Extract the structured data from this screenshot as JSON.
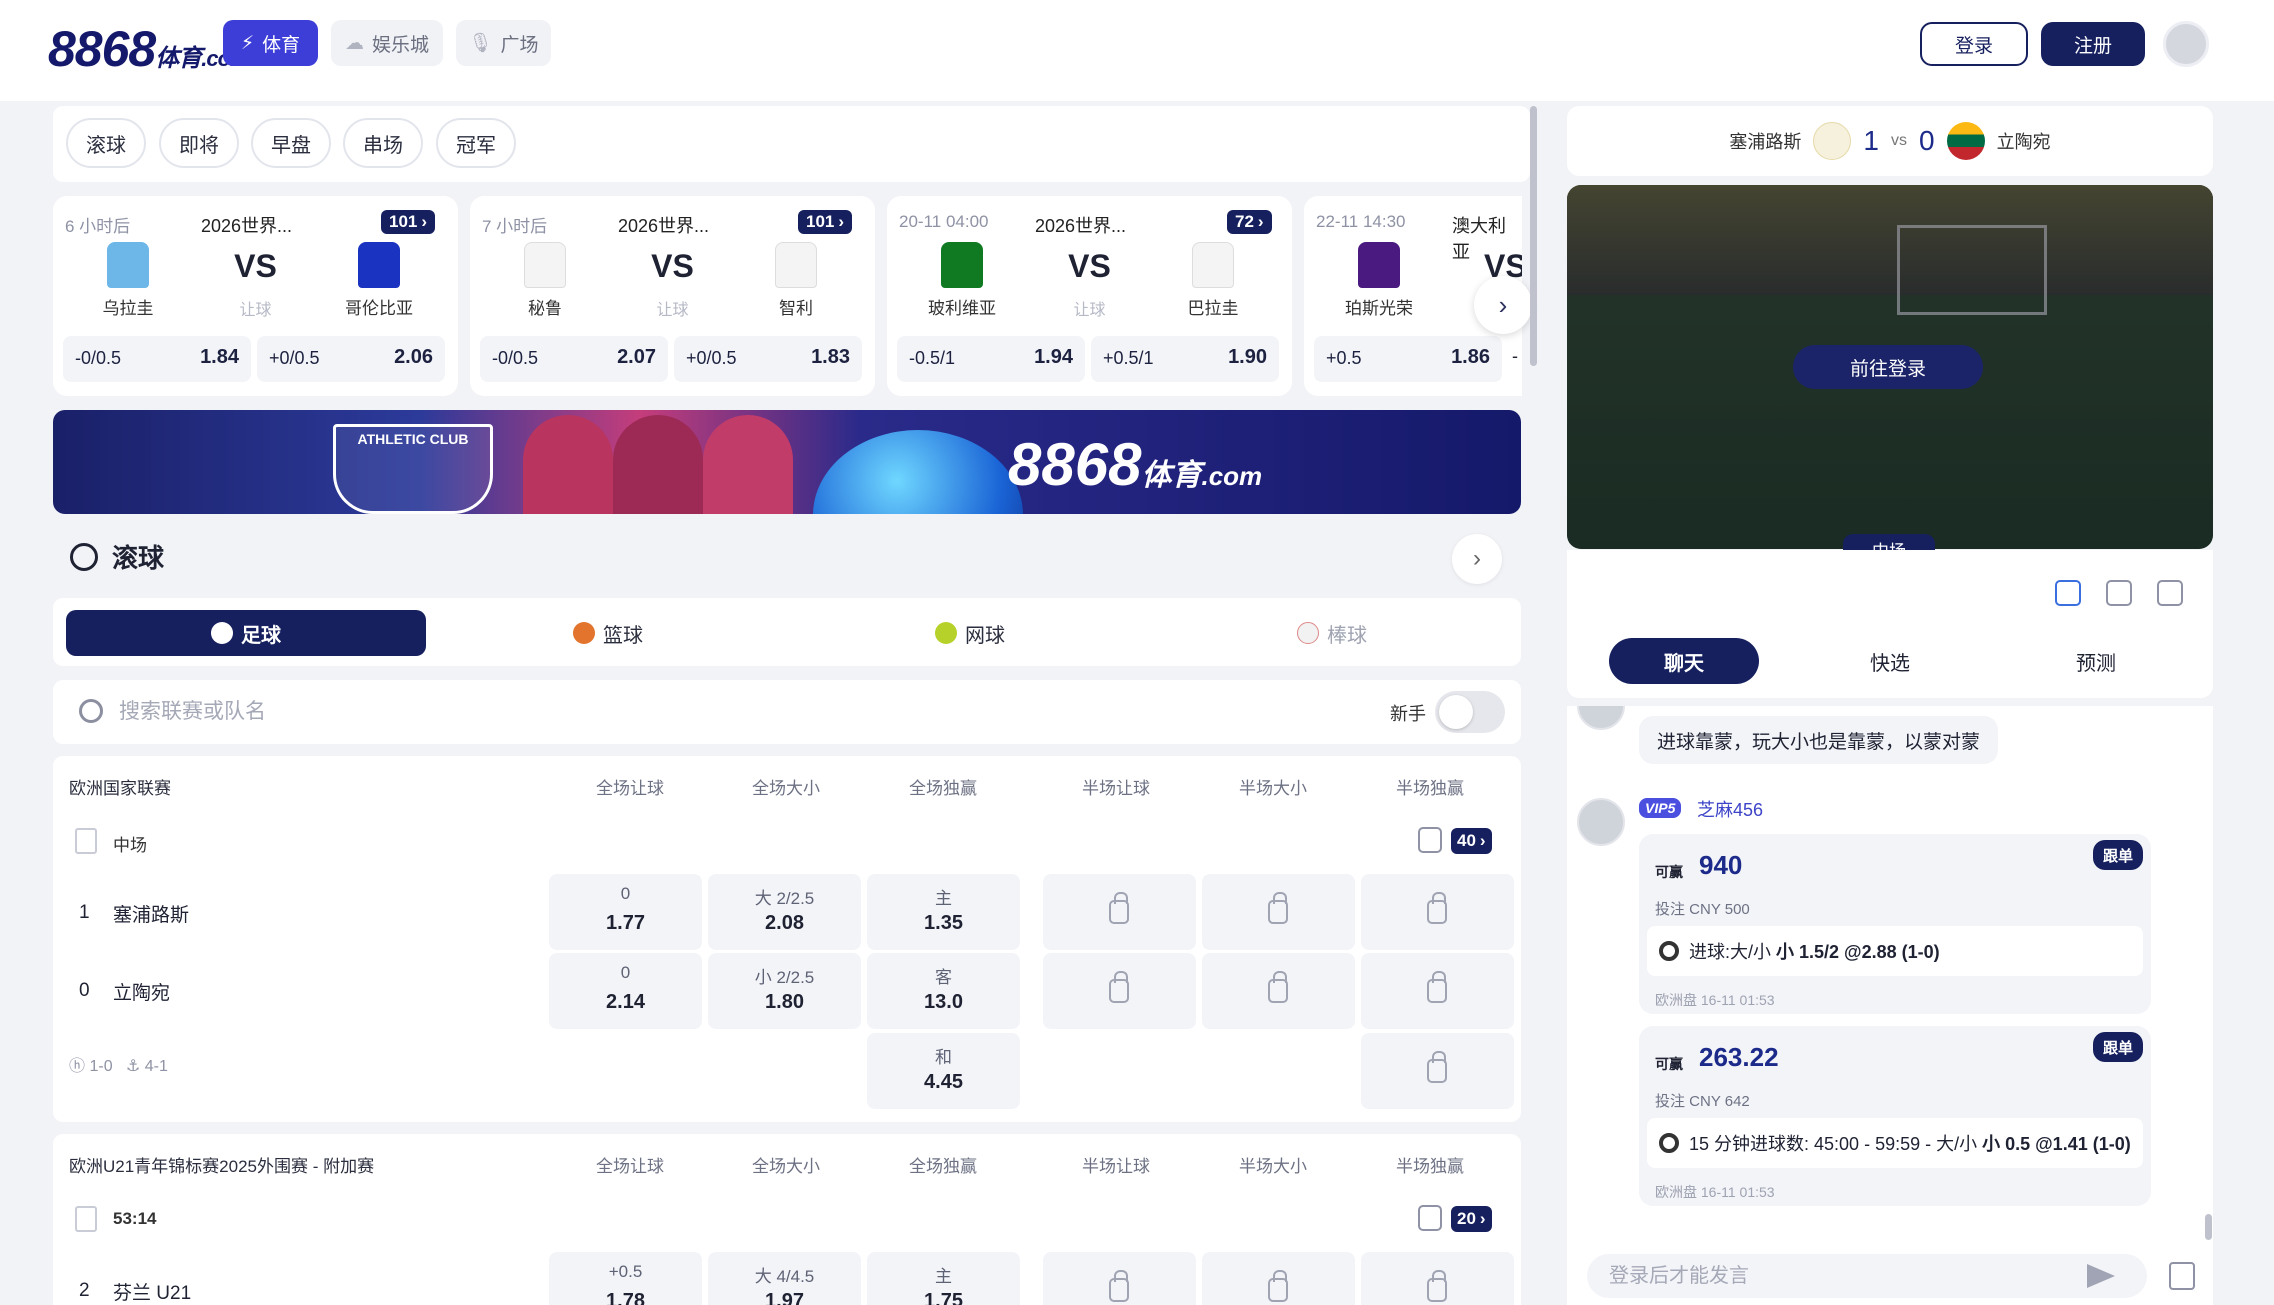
{
  "header": {
    "logo_text": "8868",
    "logo_cn": "体育",
    "logo_com": ".com",
    "nav": [
      {
        "label": "体育"
      },
      {
        "label": "娱乐城"
      },
      {
        "label": "广场"
      }
    ],
    "login": "登录",
    "register": "注册"
  },
  "tabs": [
    "滚球",
    "即将",
    "早盘",
    "串场",
    "冠军"
  ],
  "cards": [
    {
      "time": "6 小时后",
      "league": "2026世界...",
      "badge": "101",
      "home": "乌拉圭",
      "away": "哥伦比亚",
      "vs": "VS",
      "sub": "让球",
      "hcap_l": "-0/0.5",
      "odd_l": "1.84",
      "hcap_r": "+0/0.5",
      "odd_r": "2.06"
    },
    {
      "time": "7 小时后",
      "league": "2026世界...",
      "badge": "101",
      "home": "秘鲁",
      "away": "智利",
      "vs": "VS",
      "sub": "让球",
      "hcap_l": "-0/0.5",
      "odd_l": "2.07",
      "hcap_r": "+0/0.5",
      "odd_r": "1.83"
    },
    {
      "time": "20-11 04:00",
      "league": "2026世界...",
      "badge": "72",
      "home": "玻利维亚",
      "away": "巴拉圭",
      "vs": "VS",
      "sub": "让球",
      "hcap_l": "-0.5/1",
      "odd_l": "1.94",
      "hcap_r": "+0.5/1",
      "odd_r": "1.90"
    },
    {
      "time": "22-11 14:30",
      "league": "澳大利亚",
      "badge": "",
      "home": "珀斯光荣",
      "away": "",
      "vs": "VS",
      "sub": "",
      "hcap_l": "+0.5",
      "odd_l": "1.86",
      "hcap_r": "-",
      "odd_r": ""
    }
  ],
  "banner": {
    "brand": "8868",
    "brand_cn": "体育",
    "brand_com": ".com",
    "club": "ATHLETIC CLUB"
  },
  "live": {
    "title": "滚球"
  },
  "sports": [
    {
      "label": "足球"
    },
    {
      "label": "篮球"
    },
    {
      "label": "网球"
    },
    {
      "label": "棒球"
    }
  ],
  "search": {
    "placeholder": "搜索联赛或队名",
    "novice": "新手"
  },
  "columns": [
    "全场让球",
    "全场大小",
    "全场独赢",
    "半场让球",
    "半场大小",
    "半场独赢"
  ],
  "leagues": [
    {
      "name": "欧洲国家联赛",
      "status": "中场",
      "count": "40",
      "rows": [
        {
          "score": "1",
          "team": "塞浦路斯",
          "hcap": "0",
          "hcap_odd": "1.77",
          "ou": "大 2/2.5",
          "ou_odd": "2.08",
          "win": "主",
          "win_odd": "1.35"
        },
        {
          "score": "0",
          "team": "立陶宛",
          "hcap": "0",
          "hcap_odd": "2.14",
          "ou": "小 2/2.5",
          "ou_odd": "1.80",
          "win": "客",
          "win_odd": "13.0"
        }
      ],
      "draw": {
        "label": "和",
        "odd": "4.45"
      },
      "ht": "1-0",
      "corner": "4-1"
    },
    {
      "name": "欧洲U21青年锦标赛2025外围赛 - 附加赛",
      "status": "53:14",
      "count": "20",
      "rows": [
        {
          "score": "2",
          "team": "芬兰 U21",
          "hcap": "+0.5",
          "hcap_odd": "1.78",
          "ou": "大 4/4.5",
          "ou_odd": "1.97",
          "win": "主",
          "win_odd": "1.75"
        }
      ]
    }
  ],
  "match": {
    "home": "塞浦路斯",
    "home_score": "1",
    "vs": "vs",
    "away_score": "0",
    "away": "立陶宛",
    "go_login": "前往登录",
    "period": "中场"
  },
  "chat_tabs": [
    "聊天",
    "快选",
    "预测"
  ],
  "chat": {
    "msg1": "进球靠蒙，玩大小也是靠蒙，以蒙对蒙",
    "user": "芝麻456",
    "vip": "VIP5",
    "bets": [
      {
        "win_label": "可赢",
        "win": "940",
        "follow": "跟单",
        "stake": "投注 CNY 500",
        "sel_a": "进球:大/小 ",
        "sel_b": "小 1.5/2 @2.88 (1-0)",
        "time": "欧洲盘 16-11 01:53"
      },
      {
        "win_label": "可赢",
        "win": "263.22",
        "follow": "跟单",
        "stake": "投注 CNY 642",
        "sel_a": "15 分钟进球数: 45:00 - 59:59 - 大/小 ",
        "sel_b": "小 0.5 @1.41 (1-0)",
        "time": "欧洲盘 16-11 01:53"
      }
    ],
    "input_placeholder": "登录后才能发言"
  },
  "colors": {
    "brand": "#16205e",
    "accent": "#3d3ed8"
  }
}
